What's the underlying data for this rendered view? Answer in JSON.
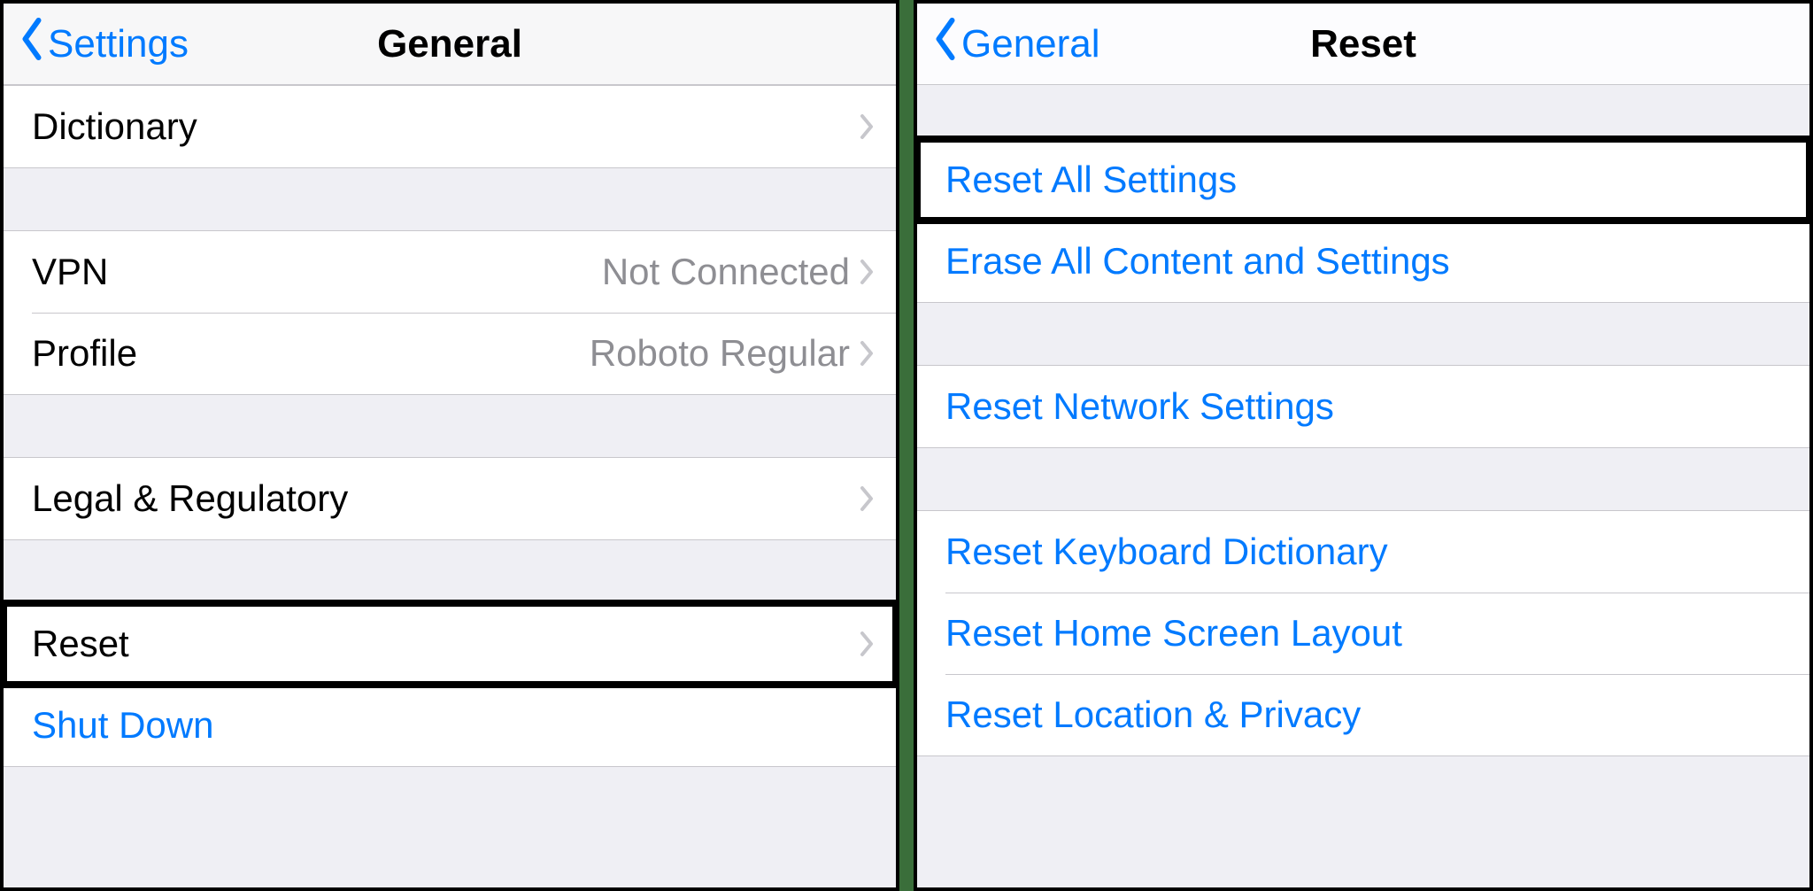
{
  "colors": {
    "link": "#007aff",
    "detail": "#8e8e93"
  },
  "left": {
    "back_label": "Settings",
    "title": "General",
    "rows": {
      "dictionary": "Dictionary",
      "vpn": "VPN",
      "vpn_status": "Not Connected",
      "profile": "Profile",
      "profile_value": "Roboto Regular",
      "legal": "Legal & Regulatory",
      "reset": "Reset",
      "shutdown": "Shut Down"
    }
  },
  "right": {
    "back_label": "General",
    "title": "Reset",
    "rows": {
      "reset_all": "Reset All Settings",
      "erase_all": "Erase All Content and Settings",
      "reset_network": "Reset Network Settings",
      "reset_keyboard": "Reset Keyboard Dictionary",
      "reset_home": "Reset Home Screen Layout",
      "reset_location": "Reset Location & Privacy"
    }
  }
}
